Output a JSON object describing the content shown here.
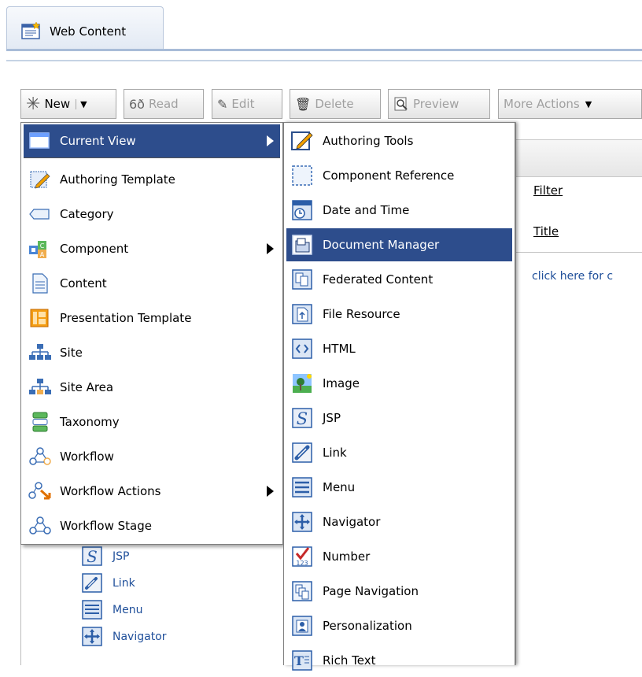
{
  "tab": {
    "label": "Web Content"
  },
  "toolbar": {
    "new": "New",
    "read": "Read",
    "edit": "Edit",
    "delete": "Delete",
    "preview": "Preview",
    "more_actions": "More Actions"
  },
  "panel": {
    "filter": "Filter",
    "title": "Title",
    "link": "click here for c"
  },
  "tree": {
    "items": [
      "JSP",
      "Link",
      "Menu",
      "Navigator"
    ]
  },
  "menu1": {
    "items": [
      {
        "label": "Current View",
        "icon": "window-icon",
        "submenu": true,
        "selected": true
      },
      {
        "label": "Authoring Template",
        "icon": "authoring-template-icon"
      },
      {
        "label": "Category",
        "icon": "tag-icon"
      },
      {
        "label": "Component",
        "icon": "component-icon",
        "submenu": true
      },
      {
        "label": "Content",
        "icon": "document-icon"
      },
      {
        "label": "Presentation Template",
        "icon": "presentation-template-icon"
      },
      {
        "label": "Site",
        "icon": "site-hierarchy-icon"
      },
      {
        "label": "Site Area",
        "icon": "site-area-icon"
      },
      {
        "label": "Taxonomy",
        "icon": "taxonomy-icon"
      },
      {
        "label": "Workflow",
        "icon": "workflow-icon"
      },
      {
        "label": "Workflow Actions",
        "icon": "workflow-actions-icon",
        "submenu": true
      },
      {
        "label": "Workflow Stage",
        "icon": "workflow-stage-icon"
      }
    ]
  },
  "menu2": {
    "items": [
      {
        "label": "Authoring Tools",
        "icon": "authoring-tools-icon"
      },
      {
        "label": "Component Reference",
        "icon": "component-reference-icon"
      },
      {
        "label": "Date and Time",
        "icon": "clock-icon"
      },
      {
        "label": "Document Manager",
        "icon": "document-manager-icon",
        "selected": true
      },
      {
        "label": "Federated Content",
        "icon": "federated-content-icon"
      },
      {
        "label": "File Resource",
        "icon": "file-resource-icon"
      },
      {
        "label": "HTML",
        "icon": "html-icon"
      },
      {
        "label": "Image",
        "icon": "image-icon"
      },
      {
        "label": "JSP",
        "icon": "jsp-icon"
      },
      {
        "label": "Link",
        "icon": "link-icon"
      },
      {
        "label": "Menu",
        "icon": "menu-icon"
      },
      {
        "label": "Navigator",
        "icon": "navigator-icon"
      },
      {
        "label": "Number",
        "icon": "number-icon"
      },
      {
        "label": "Page Navigation",
        "icon": "page-navigation-icon"
      },
      {
        "label": "Personalization",
        "icon": "personalization-icon"
      },
      {
        "label": "Rich Text",
        "icon": "rich-text-icon"
      }
    ]
  },
  "colors": {
    "selection": "#2d4d8c",
    "link": "#1f4f9a"
  }
}
